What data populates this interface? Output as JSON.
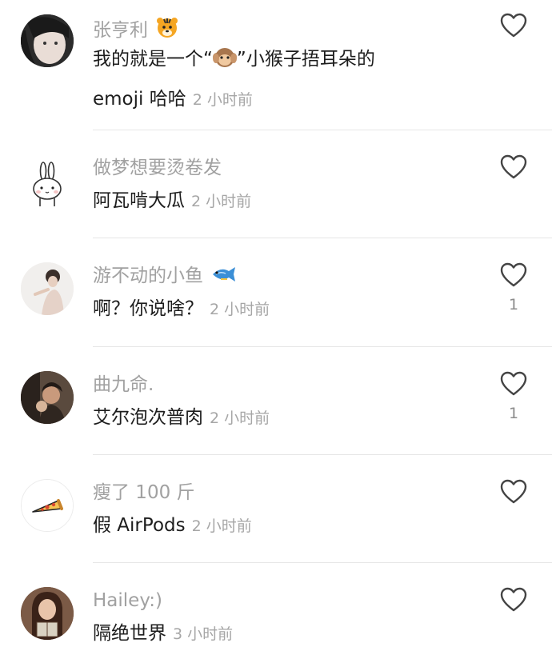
{
  "colors": {
    "username": "#a1a1a1",
    "text": "#1d1d1d",
    "time": "#a6a6a6",
    "divider": "#e6e6e6"
  },
  "comments": [
    {
      "username": "张亨利",
      "badge_icon": "tiger-emoji-icon",
      "text_line1_before": "我的就是一个“",
      "text_inline_icon": "see-no-evil-monkey-emoji-icon",
      "text_line1_after": "”小猴子捂耳朵的",
      "text_line2": "emoji 哈哈",
      "time": "2 小时前",
      "like_count": "",
      "like_icon": "heart-outline-icon"
    },
    {
      "username": "做梦想要烫卷发",
      "text": "阿瓦啃大瓜",
      "time": "2 小时前",
      "like_count": "",
      "like_icon": "heart-outline-icon"
    },
    {
      "username": "游不动的小鱼",
      "badge_icon": "fish-emoji-icon",
      "text": "啊？你说啥？",
      "time": "2 小时前",
      "like_count": "1",
      "like_icon": "heart-outline-icon"
    },
    {
      "username": "曲九命.",
      "text": "艾尔泡次普肉",
      "time": "2 小时前",
      "like_count": "1",
      "like_icon": "heart-outline-icon"
    },
    {
      "username": "瘦了 100 斤",
      "text": "假 AirPods",
      "time": "2 小时前",
      "like_count": "",
      "like_icon": "heart-outline-icon"
    },
    {
      "username": "Hailey:)",
      "text": "隔绝世界",
      "time": "3 小时前",
      "like_count": "",
      "like_icon": "heart-outline-icon"
    }
  ]
}
